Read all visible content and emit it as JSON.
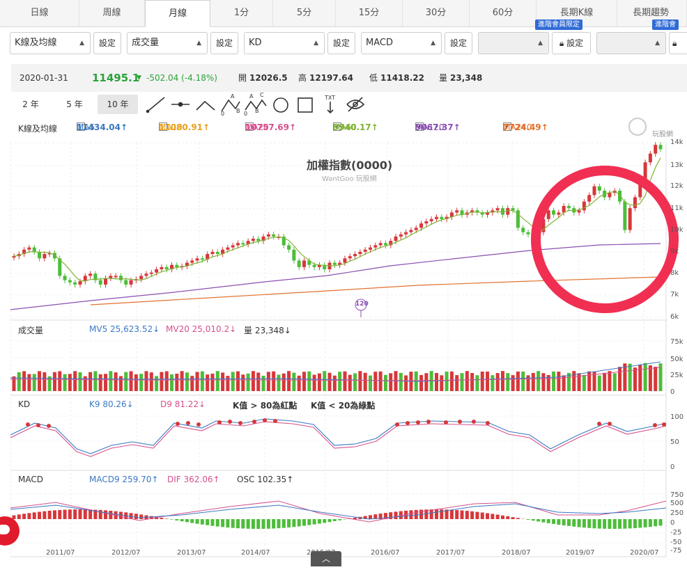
{
  "tabs": [
    "日線",
    "周線",
    "月線",
    "1分",
    "5分",
    "15分",
    "30分",
    "60分",
    "長期K線",
    "長期趨勢"
  ],
  "selectors": {
    "s1": "K線及均線",
    "s2": "成交量",
    "s3": "KD",
    "s4": "MACD",
    "settings": "設定",
    "members_badge": "進階會員限定",
    "members_badge2": "進階會"
  },
  "info": {
    "date": "2020-01-31",
    "close": "11495.1",
    "change": "-502.04 (-4.18%)",
    "open_label": "開",
    "open": "12026.5",
    "high_label": "高",
    "high": "12197.64",
    "low_label": "低",
    "low": "11418.22",
    "vol_label": "量",
    "vol": "23,348"
  },
  "ranges": [
    "2 年",
    "5 年",
    "10 年"
  ],
  "ma": {
    "label": "K線及均線",
    "items": [
      {
        "name": "MA5",
        "val": "11434.04↑",
        "color": "#3a78c3",
        "checked": false
      },
      {
        "name": "MA10",
        "val": "11080.91↑",
        "color": "#e8a11c",
        "checked": false
      },
      {
        "name": "MA20",
        "val": "10757.69↑",
        "color": "#d6508c",
        "checked": false
      },
      {
        "name": "MA60",
        "val": "9940.17↑",
        "color": "#7fb334",
        "checked": true
      },
      {
        "name": "MA120",
        "val": "9067.37↑",
        "color": "#8a4fb0",
        "checked": true
      },
      {
        "name": "MA240",
        "val": "7724.49↑",
        "color": "#e2712c",
        "checked": true
      }
    ]
  },
  "main": {
    "title": "加權指數(0000)",
    "watermark": "WantGoo 玩股網",
    "logo_text": "玩股網",
    "marker": "120",
    "yticks": [
      "14k",
      "13k",
      "12k",
      "11k",
      "10k",
      "9k",
      "8k",
      "7k",
      "6k"
    ]
  },
  "volume": {
    "label": "成交量",
    "mv5": "MV5 25,623.52↓",
    "mv20": "MV20 25,010.2↓",
    "amt": "量 23,348↓",
    "yticks": [
      "75k",
      "50k",
      "25k",
      "0"
    ]
  },
  "kd": {
    "label": "KD",
    "k9": "K9 80.26↓",
    "d9": "D9 81.22↓",
    "note1": "K值 > 80為紅點",
    "note2": "K值 < 20為綠點",
    "yticks": [
      "100",
      "50",
      "0"
    ]
  },
  "macd": {
    "label": "MACD",
    "macd9": "MACD9 259.70↑",
    "dif": "DIF 362.06↑",
    "osc": "OSC 102.35↑",
    "yticks": [
      "750",
      "500",
      "250",
      "0",
      "-25",
      "-50",
      "-75"
    ]
  },
  "xaxis": [
    "2011/07",
    "2012/07",
    "2013/07",
    "2014/07",
    "2015/07",
    "2016/07",
    "2017/07",
    "2018/07",
    "2019/07",
    "2020/07"
  ],
  "colors": {
    "up": "#d7373a",
    "down": "#4dbd3a",
    "ma60": "#7fb334",
    "ma120": "#8a4fb0",
    "ma240": "#e2712c",
    "k": "#3a78c3",
    "d": "#d6508c",
    "highlight": "#f02f52"
  }
}
